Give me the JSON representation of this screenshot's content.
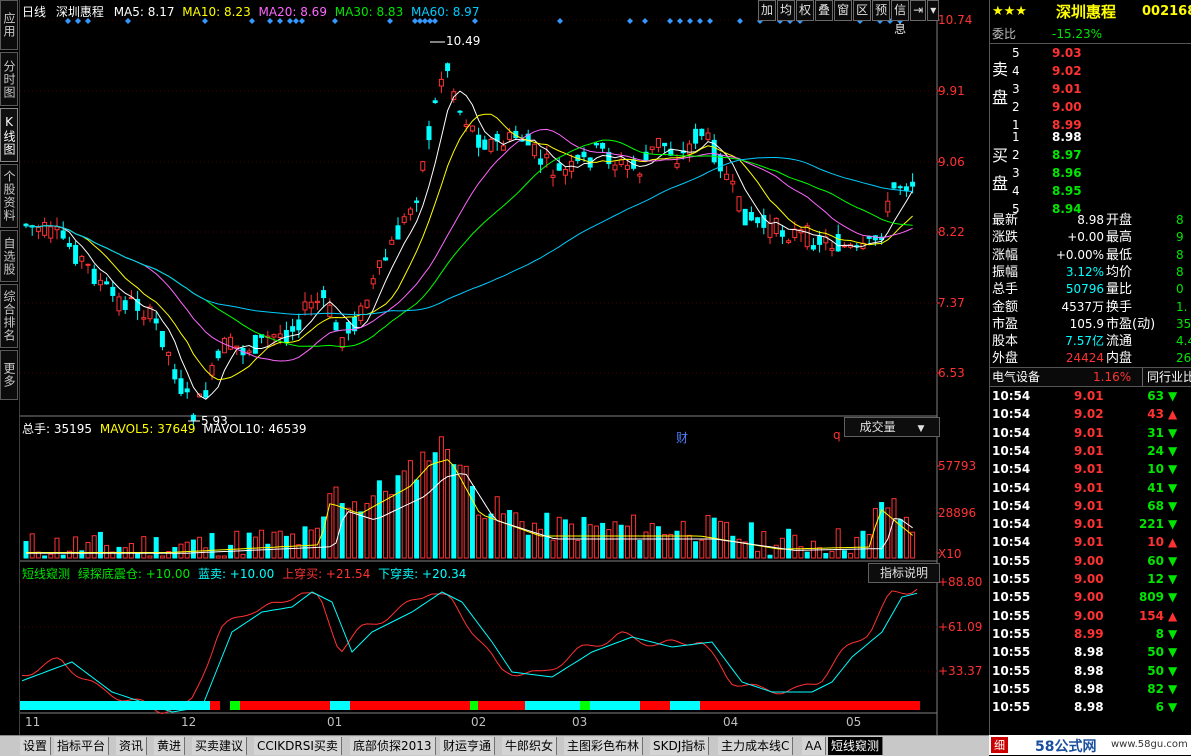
{
  "left_tabs": [
    "应用",
    "分时图",
    "K线图",
    "个股资料",
    "自选股",
    "综合排名",
    "更多"
  ],
  "left_tab_active": 2,
  "kline_header": {
    "period": "日线",
    "name": "深圳惠程",
    "ma5": "MA5: 8.17",
    "ma10": "MA10: 8.23",
    "ma20": "MA20: 8.69",
    "ma30": "MA30: 8.83",
    "ma60": "MA60: 8.97"
  },
  "top_buttons": [
    "加",
    "均",
    "权",
    "叠",
    "窗",
    "区",
    "预",
    "信息",
    "⇥",
    "▾"
  ],
  "price_axis": [
    "10.74",
    "9.91",
    "9.06",
    "8.22",
    "7.37",
    "6.53"
  ],
  "annotations": {
    "high": "10.49",
    "low": "5.93",
    "cai": "财",
    "q": "q"
  },
  "volume_header": {
    "total": "总手: 35195",
    "mavol5": "MAVOL5: 37649",
    "mavol10": "MAVOL10: 46539"
  },
  "volume_selector": "成交量",
  "volume_axis": [
    "57793",
    "28896",
    "X10"
  ],
  "indicator_header": {
    "name": "短线窥测",
    "a": "绿探底震仓: +10.00",
    "b": "蓝卖: +10.00",
    "c": "上穿买: +21.54",
    "d": "下穿卖: +20.34"
  },
  "indicator_button": "指标说明",
  "indicator_axis": [
    "+88.80",
    "+61.09",
    "+33.37"
  ],
  "date_axis": [
    "11",
    "12",
    "01",
    "02",
    "03",
    "04",
    "05"
  ],
  "stock": {
    "stars": "★★★",
    "name": "深圳惠程",
    "code": "002168"
  },
  "weibi": {
    "label": "委比",
    "value": "-15.23%"
  },
  "sell_side_label": "卖盘",
  "buy_side_label": "买盘",
  "sell": [
    {
      "n": "5",
      "p": "9.03"
    },
    {
      "n": "4",
      "p": "9.02"
    },
    {
      "n": "3",
      "p": "9.01"
    },
    {
      "n": "2",
      "p": "9.00"
    },
    {
      "n": "1",
      "p": "8.99"
    }
  ],
  "buy": [
    {
      "n": "1",
      "p": "8.98"
    },
    {
      "n": "2",
      "p": "8.97"
    },
    {
      "n": "3",
      "p": "8.96"
    },
    {
      "n": "4",
      "p": "8.95"
    },
    {
      "n": "5",
      "p": "8.94"
    }
  ],
  "quote": [
    {
      "l": "最新",
      "v": "8.98",
      "l2": "开盘",
      "v2": "8"
    },
    {
      "l": "涨跌",
      "v": "+0.00",
      "l2": "最高",
      "v2": "9"
    },
    {
      "l": "涨幅",
      "v": "+0.00%",
      "l2": "最低",
      "v2": "8"
    },
    {
      "l": "振幅",
      "v": "3.12%",
      "l2": "均价",
      "v2": "8"
    },
    {
      "l": "总手",
      "v": "50796",
      "l2": "量比",
      "v2": "0"
    },
    {
      "l": "金额",
      "v": "4537万",
      "l2": "换手",
      "v2": "1."
    },
    {
      "l": "市盈",
      "v": "105.9",
      "l2": "市盈(动)",
      "v2": "35"
    },
    {
      "l": "股本",
      "v": "7.57亿",
      "l2": "流通",
      "v2": "4.4"
    },
    {
      "l": "外盘",
      "v": "24424",
      "l2": "内盘",
      "v2": "26"
    }
  ],
  "industry": {
    "name": "电气设备",
    "pct": "1.16%",
    "peer": "同行业比"
  },
  "ticks": [
    {
      "t": "10:54",
      "p": "9.01",
      "v": "63",
      "d": "down"
    },
    {
      "t": "10:54",
      "p": "9.02",
      "v": "43",
      "d": "up"
    },
    {
      "t": "10:54",
      "p": "9.01",
      "v": "31",
      "d": "down"
    },
    {
      "t": "10:54",
      "p": "9.01",
      "v": "24",
      "d": "down"
    },
    {
      "t": "10:54",
      "p": "9.01",
      "v": "10",
      "d": "down"
    },
    {
      "t": "10:54",
      "p": "9.01",
      "v": "41",
      "d": "down"
    },
    {
      "t": "10:54",
      "p": "9.01",
      "v": "68",
      "d": "down"
    },
    {
      "t": "10:54",
      "p": "9.01",
      "v": "221",
      "d": "down"
    },
    {
      "t": "10:54",
      "p": "9.01",
      "v": "10",
      "d": "up"
    },
    {
      "t": "10:55",
      "p": "9.00",
      "v": "60",
      "d": "down"
    },
    {
      "t": "10:55",
      "p": "9.00",
      "v": "12",
      "d": "down"
    },
    {
      "t": "10:55",
      "p": "9.00",
      "v": "809",
      "d": "down"
    },
    {
      "t": "10:55",
      "p": "9.00",
      "v": "154",
      "d": "up"
    },
    {
      "t": "10:55",
      "p": "8.99",
      "v": "8",
      "d": "down"
    },
    {
      "t": "10:55",
      "p": "8.98",
      "v": "50",
      "d": "down"
    },
    {
      "t": "10:55",
      "p": "8.98",
      "v": "50",
      "d": "down"
    },
    {
      "t": "10:55",
      "p": "8.98",
      "v": "82",
      "d": "down"
    },
    {
      "t": "10:55",
      "p": "8.98",
      "v": "6",
      "d": "down"
    }
  ],
  "bottom_tabs": [
    "设置",
    "指标平台",
    "资讯",
    "黄进",
    "买卖建议",
    "CCIKDRSI买卖",
    "底部侦探2013",
    "财运亨通",
    "牛郎织女",
    "主图彩色布林",
    "SKDJ指标",
    "主力成本线C",
    "AA",
    "短线窥测"
  ],
  "bottom_tab_active": 13,
  "bottom_right": {
    "detail": "细",
    "site": "58公式网",
    "url": "www.58gu.com"
  },
  "colors": {
    "up": "#ff3232",
    "down": "#00ffff",
    "ma5": "#ffffff",
    "ma10": "#ffff00",
    "ma20": "#ff66ff",
    "ma30": "#00ff00",
    "ma60": "#00ccff"
  }
}
